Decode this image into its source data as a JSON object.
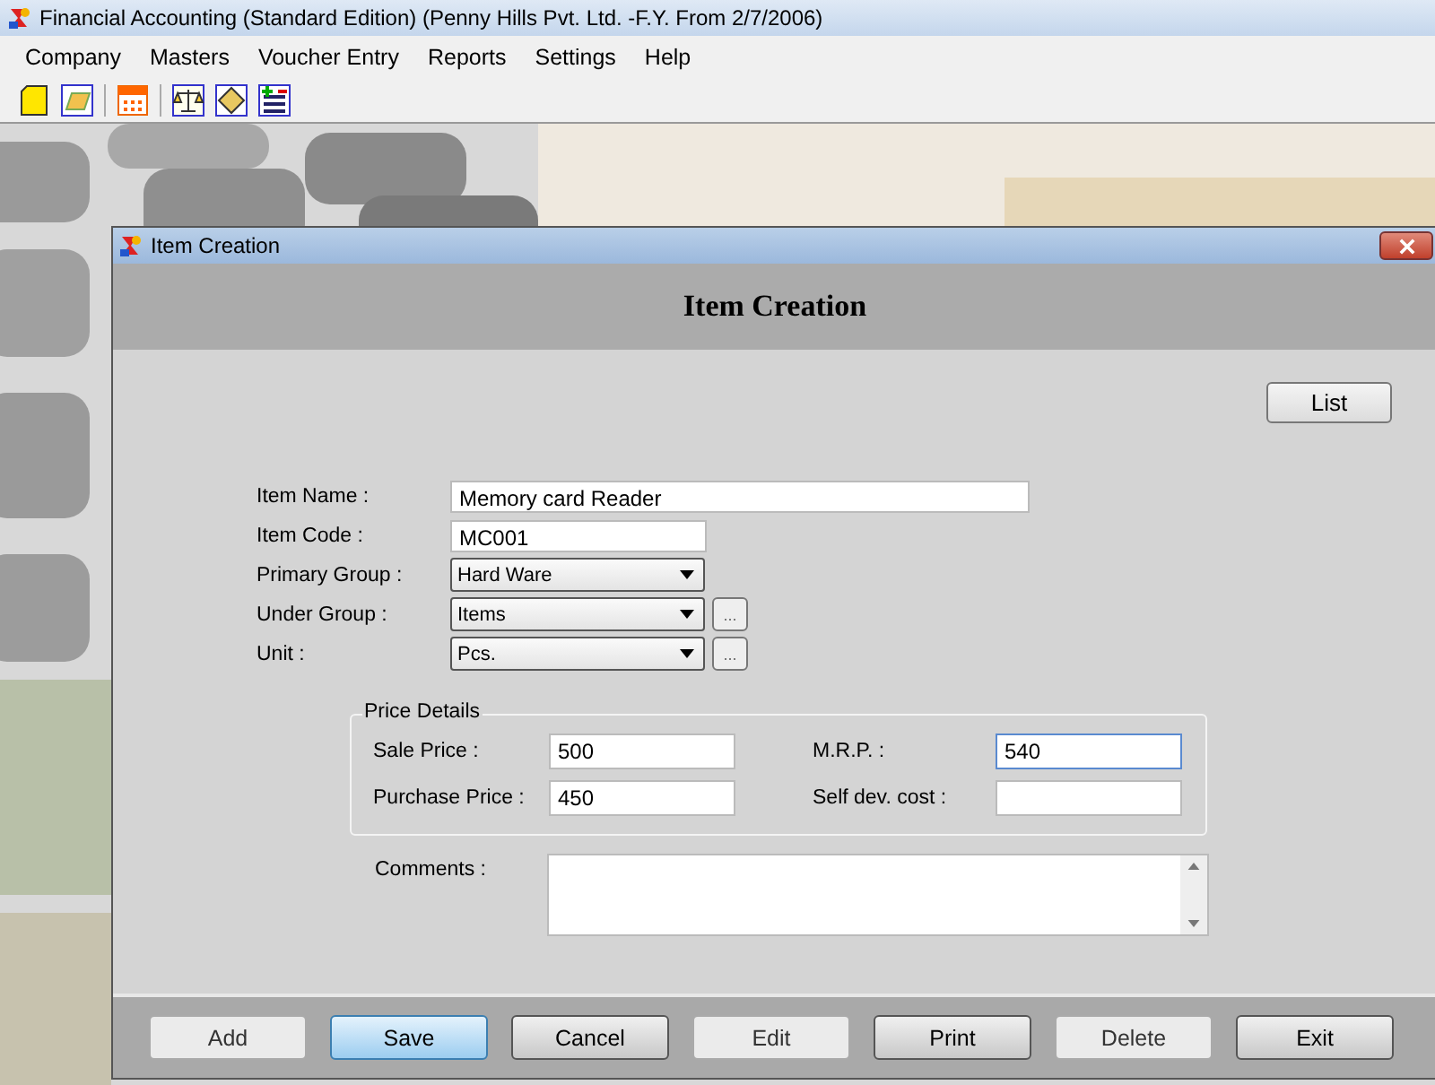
{
  "app_window": {
    "title": "Financial Accounting (Standard Edition) (Penny Hills Pvt. Ltd. -F.Y. From 2/7/2006)"
  },
  "menu": [
    "Company",
    "Masters",
    "Voucher Entry",
    "Reports",
    "Settings",
    "Help"
  ],
  "dialog": {
    "title": "Item Creation",
    "heading": "Item Creation",
    "list_button": "List",
    "fields": [
      {
        "label": "Item Name :",
        "kind": "text",
        "value": "Memory card Reader"
      },
      {
        "label": "Item Code :",
        "kind": "text",
        "value": "MC001"
      },
      {
        "label": "Primary Group :",
        "kind": "dropdown",
        "value": "Hard Ware"
      },
      {
        "label": "Under Group :",
        "kind": "dropdown_more",
        "value": "Items",
        "more": "..."
      },
      {
        "label": "Unit :",
        "kind": "dropdown_more",
        "value": "Pcs.",
        "more": "..."
      }
    ],
    "price_details": {
      "legend": "Price Details",
      "fields": [
        {
          "label": "Sale Price :",
          "value": "500",
          "focused": false
        },
        {
          "label": "M.R.P. :",
          "value": "540",
          "focused": true
        },
        {
          "label": "Purchase Price :",
          "value": "450",
          "focused": false
        },
        {
          "label": "Self dev. cost :",
          "focused": false
        }
      ]
    },
    "comments": {
      "label": "Comments :"
    },
    "buttons": [
      {
        "label": "Add",
        "disabled": true,
        "focused": false
      },
      {
        "label": "Save",
        "disabled": false,
        "focused": true
      },
      {
        "label": "Cancel",
        "disabled": false,
        "focused": false
      },
      {
        "label": "Edit",
        "disabled": true,
        "focused": false
      },
      {
        "label": "Print",
        "disabled": false,
        "focused": false
      },
      {
        "label": "Delete",
        "disabled": true,
        "focused": false
      },
      {
        "label": "Exit",
        "disabled": false,
        "focused": false
      }
    ]
  }
}
